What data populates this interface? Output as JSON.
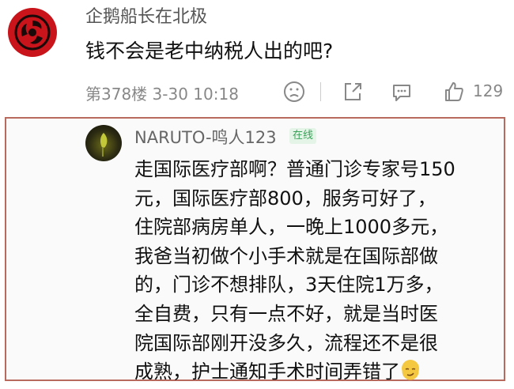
{
  "comment": {
    "username": "企鹅船长在北极",
    "text": "钱不会是老中纳税人出的吧?",
    "floor_time": "第378楼 3-30 10:18",
    "like_count": "129",
    "icons": [
      "sad-face-icon",
      "share-icon",
      "reply-icon",
      "thumbs-up-icon"
    ]
  },
  "reply": {
    "username": "NARUTO-鸣人123",
    "badge": "在线",
    "lines": [
      "走国际医疗部啊？普通门诊专家号150",
      "元，国际医疗部800，服务可好了，",
      "住院部病房单人，一晚上1000多元，",
      "我爸当初做个小手术就是在国际部做",
      "的，门诊不想排队，3天住院1万多，",
      "全自费，只有一点不好，就是当时医",
      "院国际部刚开没多久，流程还不是很",
      "成熟，护士通知手术时间弄错了"
    ],
    "trailing_emoji": "smirk-emoji-icon"
  },
  "colors": {
    "avatar_red": "#c8141a",
    "reply_border": "#b86a5e",
    "online_badge": "#3aa35a"
  }
}
